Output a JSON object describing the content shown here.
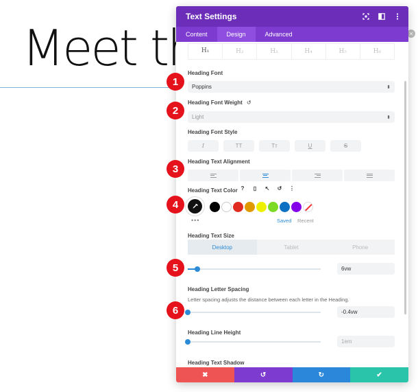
{
  "background": {
    "heading_text": "Meet th"
  },
  "panel": {
    "title": "Text Settings",
    "icons": [
      "fullscreen-icon",
      "split-view-icon",
      "more-icon"
    ],
    "tabs": [
      {
        "label": "Content"
      },
      {
        "label": "Design"
      },
      {
        "label": "Advanced"
      }
    ]
  },
  "heading_levels": [
    "H₁",
    "H₂",
    "H₃",
    "H₄",
    "H₅",
    "H₆"
  ],
  "font": {
    "label": "Heading Font",
    "value": "Poppins"
  },
  "weight": {
    "label": "Heading Font Weight",
    "reset": "↺",
    "value": "Light"
  },
  "font_style": {
    "label": "Heading Font Style",
    "buttons": [
      "I",
      "TT",
      "Tᴛ",
      "U",
      "S"
    ]
  },
  "alignment": {
    "label": "Heading Text Alignment"
  },
  "text_color": {
    "label": "Heading Text Color",
    "tools": [
      "?",
      "▯",
      "↖",
      "↺",
      "⋮"
    ],
    "picker_icon": "✎",
    "swatches": [
      "#000000",
      "#ffffff",
      "#e02b20",
      "#e09900",
      "#edf000",
      "#7cda24",
      "#0c71c3",
      "#8300e9"
    ],
    "more": "•••",
    "saved": "Saved",
    "recent": "Recent"
  },
  "text_size": {
    "label": "Heading Text Size",
    "devices": [
      "Desktop",
      "Tablet",
      "Phone"
    ],
    "value": "6vw",
    "level": 0.07
  },
  "letter_spacing": {
    "label": "Heading Letter Spacing",
    "description": "Letter spacing adjusts the distance between each letter in the Heading.",
    "value": "-0.4vw",
    "level": 0.0
  },
  "line_height": {
    "label": "Heading Line Height",
    "value": "1em",
    "level": 0.0
  },
  "text_shadow": {
    "label": "Heading Text Shadow"
  },
  "bottom_bar": {
    "cancel": "✖",
    "undo": "↺",
    "redo": "↻",
    "save": "✔"
  },
  "markers": [
    "1",
    "2",
    "3",
    "4",
    "5",
    "6"
  ],
  "colors": {
    "header": "#6c2eb9",
    "tabs": "#7e3bd0",
    "accent": "#2c8bd6",
    "marker": "#e5121b"
  }
}
